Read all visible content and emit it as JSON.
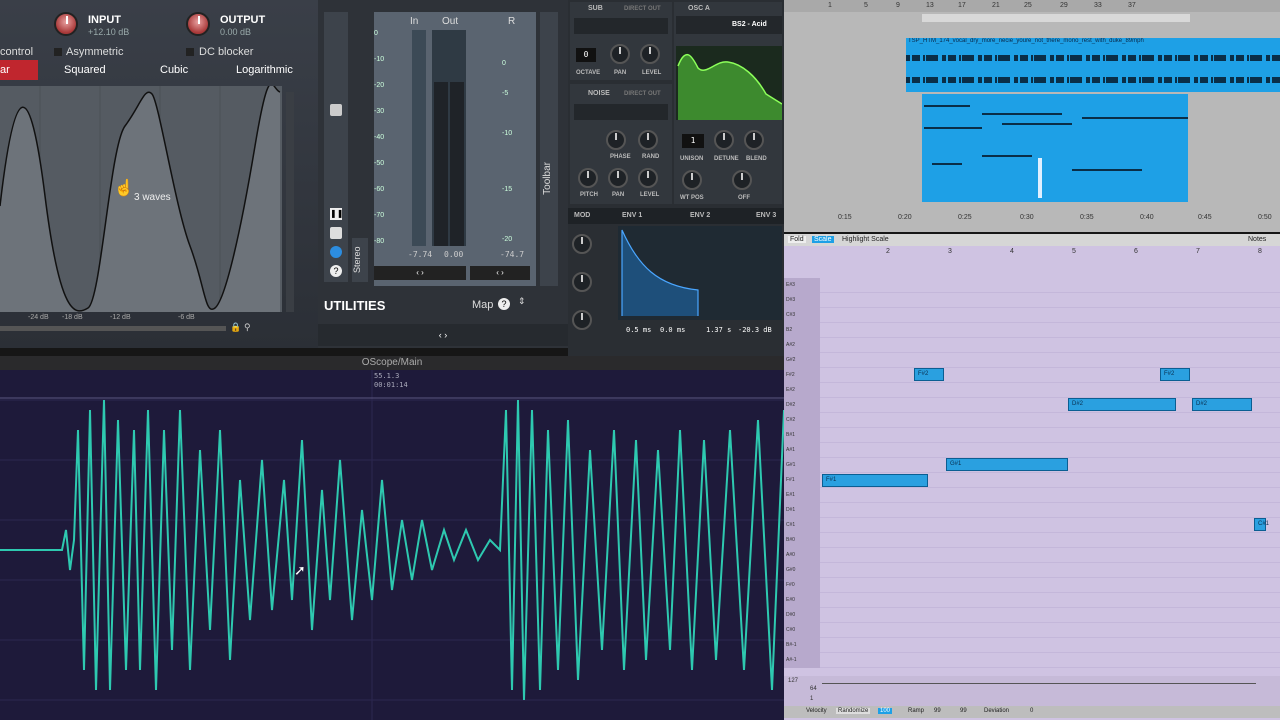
{
  "saturation": {
    "input_label": "INPUT",
    "input_value": "+12.10 dB",
    "output_label": "OUTPUT",
    "output_value": "0.00 dB",
    "control_partial": "control",
    "asymmetric": "Asymmetric",
    "dc_blocker": "DC blocker",
    "modes": [
      "ar",
      "Squared",
      "Cubic",
      "Logarithmic"
    ],
    "wave_tooltip": "3 waves",
    "db_ticks": [
      "-24 dB",
      "-18 dB",
      "-12 dB",
      "-6 dB"
    ]
  },
  "utilities": {
    "meter_headers": [
      "In",
      "Out",
      "R"
    ],
    "scale_left": [
      "0",
      "-10",
      "-20",
      "-30",
      "-40",
      "-50",
      "-60",
      "-70",
      "-80"
    ],
    "scale_right": [
      "0",
      "-5",
      "-10",
      "-15",
      "-20"
    ],
    "readouts": [
      "-7.74",
      "0.00",
      "-74.7"
    ],
    "title": "UTILITIES",
    "map_label": "Map",
    "toolbar_label": "Toolbar",
    "stereo_label": "Stereo"
  },
  "serum": {
    "sub_label": "SUB",
    "direct_out": "DIRECT OUT",
    "osc_a_label": "OSC A",
    "wavetable_name": "BS2 - Acid",
    "octave_value": "0",
    "noise_label": "NOISE",
    "unison_value": "1",
    "knob_labels_sub": [
      "OCTAVE",
      "PAN",
      "LEVEL"
    ],
    "knob_labels_osc": [
      "UNISON",
      "DETUNE",
      "BLEND"
    ],
    "knob_labels_noise": [
      "PHASE",
      "RAND"
    ],
    "knob_labels_bottom": [
      "PITCH",
      "PAN",
      "LEVEL"
    ],
    "knob_labels_wt": [
      "WT POS",
      "OFF"
    ],
    "mod_tabs": [
      "MOD",
      "ENV 1",
      "ENV 2",
      "ENV 3"
    ],
    "env_values": [
      "0.5 ms",
      "0.0 ms",
      "1.37 s",
      "-20.3 dB"
    ]
  },
  "arrangement": {
    "ruler": [
      "1",
      "5",
      "9",
      "13",
      "17",
      "21",
      "25",
      "29",
      "33",
      "37"
    ],
    "clip_name": "TSP_HTM_174_vocal_dry_more_necie_youre_not_there_mono_rest_with_duke_89mph",
    "time_ticks": [
      "0:15",
      "0:20",
      "0:25",
      "0:30",
      "0:35",
      "0:40",
      "0:45",
      "0:50"
    ]
  },
  "piano_roll": {
    "toolbar": [
      "Fold",
      "Scale",
      "Highlight Scale",
      "Notes"
    ],
    "bar_numbers": [
      "2",
      "3",
      "4",
      "5",
      "6",
      "7",
      "8"
    ],
    "keys": [
      "E#3",
      "D#3",
      "C#3",
      "B2",
      "A#2",
      "G#2",
      "F#2",
      "E#2",
      "D#2",
      "C#2",
      "B#1",
      "A#1",
      "G#1",
      "F#1",
      "E#1",
      "D#1",
      "C#1",
      "B#0",
      "A#0",
      "G#0",
      "F#0",
      "E#0",
      "D#0",
      "C#0",
      "B#-1",
      "A#-1"
    ],
    "notes": [
      {
        "label": "F#2"
      },
      {
        "label": "F#2"
      },
      {
        "label": "D#2"
      },
      {
        "label": "D#2"
      },
      {
        "label": "G#1"
      },
      {
        "label": "F#1"
      },
      {
        "label": "C#1"
      }
    ],
    "velocity_values": [
      "127",
      "64",
      "1"
    ],
    "footer": [
      "Velocity",
      "Randomize",
      "100",
      "Ramp",
      "99",
      "99",
      "Deviation",
      "0"
    ]
  },
  "oscilloscope": {
    "title": "OScope/Main",
    "position": "55.1.3",
    "time": "00:01:14"
  },
  "colors": {
    "accent_red": "#c0262e",
    "clip_blue": "#1ea0e6",
    "scope_teal": "#2ec9b0",
    "roll_bg": "#cfc3e2"
  }
}
